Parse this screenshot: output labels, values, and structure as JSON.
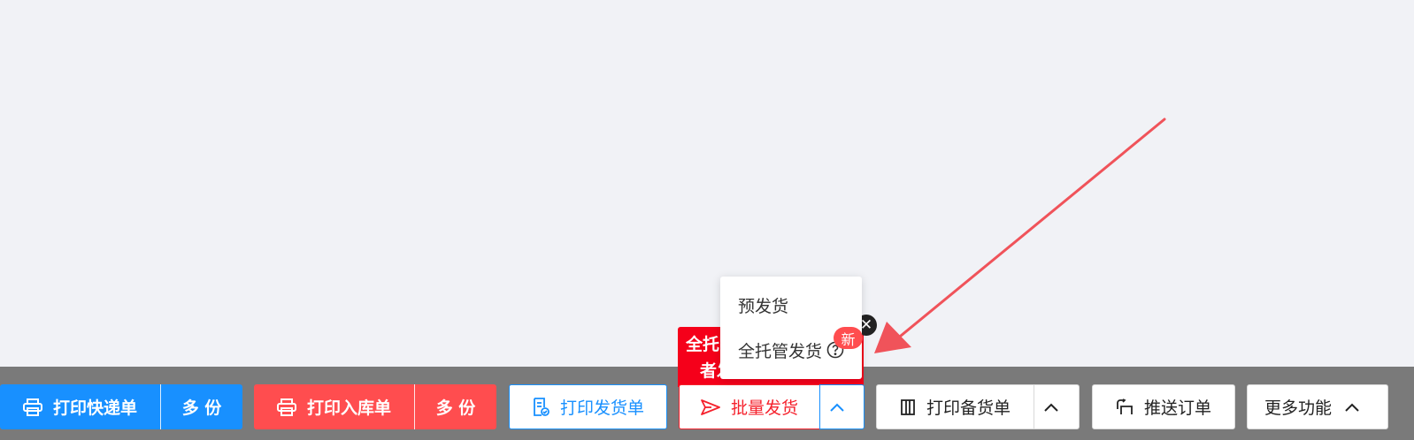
{
  "toolbar": {
    "print_express_label": "打印快递单",
    "print_express_copies_label": "多 份",
    "print_inbound_label": "打印入库单",
    "print_inbound_copies_label": "多 份",
    "print_delivery_label": "打印发货单",
    "batch_ship_label": "批量发货",
    "print_stock_label": "打印备货单",
    "push_order_label": "推送订单",
    "more_label": "更多功能"
  },
  "banner": {
    "line1": "全托",
    "line2": "者发"
  },
  "dropdown": {
    "items": [
      {
        "label": "预发货"
      },
      {
        "label": "全托管发货"
      }
    ],
    "new_badge": "新",
    "close_symbol": "✕"
  },
  "colors": {
    "primary_blue": "#1890ff",
    "danger_red": "#ff4d4f",
    "banner_red": "#f5001a",
    "toolbar_gray": "#7a7a7a",
    "background": "#f1f2f6",
    "arrow_red": "#f0535a"
  },
  "icons": {
    "print_express": "printer-icon",
    "print_inbound": "printer-icon",
    "print_delivery": "document-check-icon",
    "batch_ship": "send-icon",
    "print_stock": "columns-icon",
    "push_order": "push-icon",
    "help": "question-circle-icon",
    "chevron": "chevron-up-icon"
  }
}
